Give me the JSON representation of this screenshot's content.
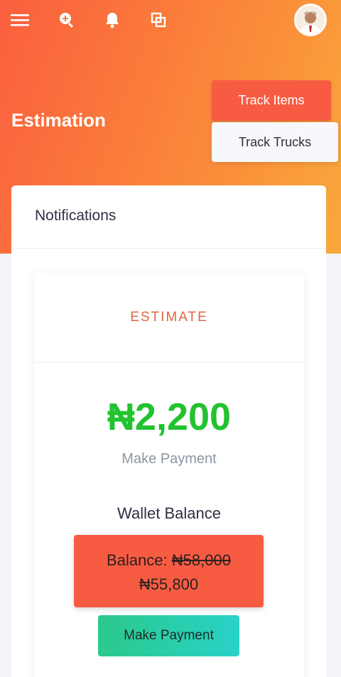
{
  "header": {
    "icons": [
      "menu-icon",
      "search-icon",
      "bell-icon",
      "copy-icon"
    ],
    "avatar": "user-avatar"
  },
  "page": {
    "title": "Estimation"
  },
  "actions": {
    "track_items": "Track Items",
    "track_trucks": "Track Trucks"
  },
  "notifications": {
    "title": "Notifications"
  },
  "estimate": {
    "label": "ESTIMATE",
    "amount": "₦2,200",
    "payment_hint": "Make Payment",
    "wallet_heading": "Wallet Balance",
    "balance_label": "Balance:",
    "balance_old": "₦58,000",
    "balance_new": "₦55,800",
    "pay_button": "Make Payment"
  },
  "colors": {
    "accent": "#f75c42",
    "amount_green": "#22c32e",
    "estimate_label": "#e0643f"
  }
}
